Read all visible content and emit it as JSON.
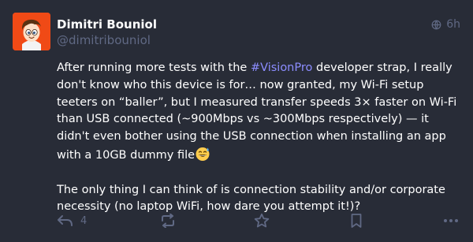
{
  "post": {
    "author": {
      "display_name": "Dimitri Bouniol",
      "handle": "@dimitribouniol"
    },
    "visibility_icon": "globe-icon",
    "timestamp": "6h",
    "paragraph1": {
      "before_hashtag": "After running more tests with the ",
      "hashtag": "#VisionPro",
      "after_hashtag": " developer strap, I really don't know who this device is for… now granted, my Wi-Fi setup teeters on “baller”, but I measured transfer speeds 3× faster on Wi-Fi than USB connected (~900Mbps vs ~300Mbps respectively) — it didn't even bother using the USB connection when installing an app with a 10GB dummy file"
    },
    "paragraph1_emoji": "grinning-sweat-emoji",
    "paragraph2": "The only thing I can think of is connection stability and/or corporate necessity (no laptop WiFi, how dare you attempt it!)?"
  },
  "actions": {
    "reply_icon": "reply-icon",
    "reply_count": "4",
    "boost_icon": "boost-icon",
    "favourite_icon": "star-icon",
    "bookmark_icon": "bookmark-icon",
    "more_icon": "more-icon"
  },
  "colors": {
    "background": "#282c37",
    "text": "#ffffff",
    "muted": "#606984",
    "hashtag": "#8c8dff",
    "avatar_background": "#f04a16"
  }
}
